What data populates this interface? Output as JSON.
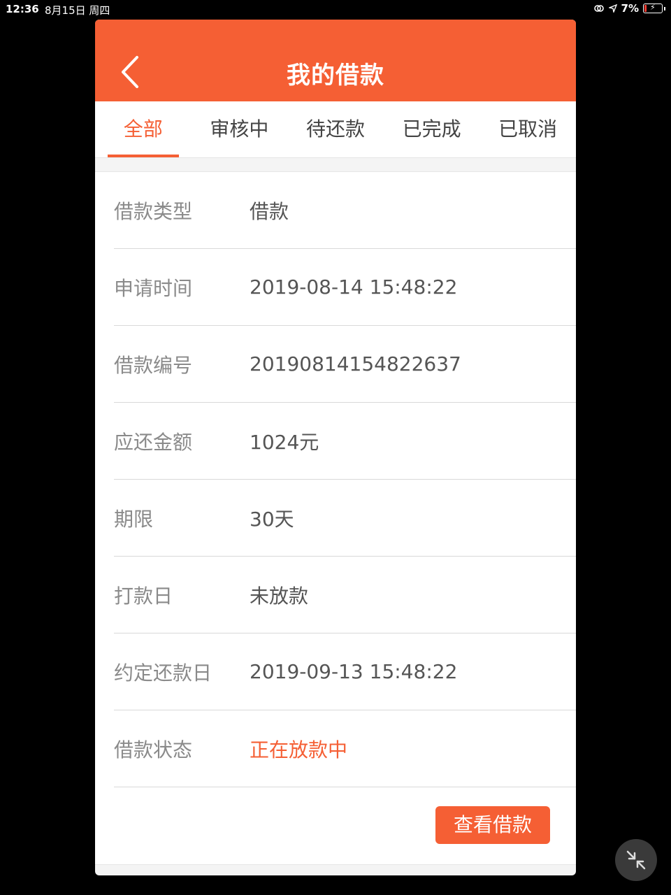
{
  "status_bar": {
    "time": "12:36",
    "date": "8月15日 周四",
    "battery": "7%"
  },
  "header": {
    "title": "我的借款",
    "back_icon": "chevron-left-icon"
  },
  "tabs": [
    {
      "label": "全部",
      "active": true
    },
    {
      "label": "审核中",
      "active": false
    },
    {
      "label": "待还款",
      "active": false
    },
    {
      "label": "已完成",
      "active": false
    },
    {
      "label": "已取消",
      "active": false
    }
  ],
  "loan": {
    "rows": [
      {
        "label": "借款类型",
        "value": "借款"
      },
      {
        "label": "申请时间",
        "value": "2019-08-14 15:48:22"
      },
      {
        "label": "借款编号",
        "value": "20190814154822637"
      },
      {
        "label": "应还金额",
        "value": "1024元"
      },
      {
        "label": "期限",
        "value": "30天"
      },
      {
        "label": "打款日",
        "value": "未放款"
      },
      {
        "label": "约定还款日",
        "value": "2019-09-13 15:48:22"
      },
      {
        "label": "借款状态",
        "value": "正在放款中"
      }
    ],
    "view_button": "查看借款"
  },
  "colors": {
    "accent": "#f55f34",
    "background": "#f4f4f4"
  }
}
